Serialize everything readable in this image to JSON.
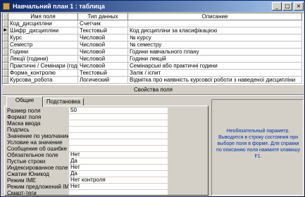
{
  "window": {
    "title": "Навчальний план 1 : таблица",
    "buttons": {
      "minimize": "_",
      "maximize": "□",
      "close": "×"
    }
  },
  "grid": {
    "headers": [
      "Имя поля",
      "Тип данных",
      "Описание"
    ],
    "selected_marker": "▶",
    "rows": [
      {
        "name": "Код_дисципліни",
        "type": "Счетчик",
        "desc": ""
      },
      {
        "name": "Шифр_дисципліни",
        "type": "Текстовый",
        "desc": "Код дисципліни за класифікацією"
      },
      {
        "name": "Курс",
        "type": "Числовой",
        "desc": "№ курсу"
      },
      {
        "name": "Семестр",
        "type": "Числовой",
        "desc": "№ семестру"
      },
      {
        "name": "Години",
        "type": "Числовой",
        "desc": "Години навчального плану"
      },
      {
        "name": "Лекції (години)",
        "type": "Числовой",
        "desc": "Години лекцій"
      },
      {
        "name": "Практичні / Семінари (годин",
        "type": "Числовой",
        "desc": "Семінарські або практичні години"
      },
      {
        "name": "Форма_контролю",
        "type": "Текстовый",
        "desc": "Залік / іспит"
      },
      {
        "name": "Курсова_робота",
        "type": "Логический",
        "desc": "Відмітка про наявність курсової роботи з наведеної дисципліни"
      }
    ]
  },
  "properties": {
    "section_title": "Свойства поля",
    "tabs": [
      "Общие",
      "Подстановка"
    ],
    "rows": [
      {
        "label": "Размер поля",
        "value": "50"
      },
      {
        "label": "Формат поля",
        "value": ""
      },
      {
        "label": "Маска ввода",
        "value": ""
      },
      {
        "label": "Подпись",
        "value": ""
      },
      {
        "label": "Значение по умолчанию",
        "value": ""
      },
      {
        "label": "Условие на значение",
        "value": ""
      },
      {
        "label": "Сообщение об ошибке",
        "value": ""
      },
      {
        "label": "Обязательное поле",
        "value": "Нет"
      },
      {
        "label": "Пустые строки",
        "value": "Да"
      },
      {
        "label": "Индексированное поле",
        "value": "Нет"
      },
      {
        "label": "Сжатие Юникод",
        "value": "Да"
      },
      {
        "label": "Режим IME",
        "value": "Нет контроля"
      },
      {
        "label": "Режим предложений IME",
        "value": "Нет"
      },
      {
        "label": "Смарт-теги",
        "value": ""
      }
    ],
    "help": "Необязательный параметр. Выводится в строку состояния при выборе поля в форме. Для справки по описанию поля нажмите клавишу F1."
  }
}
